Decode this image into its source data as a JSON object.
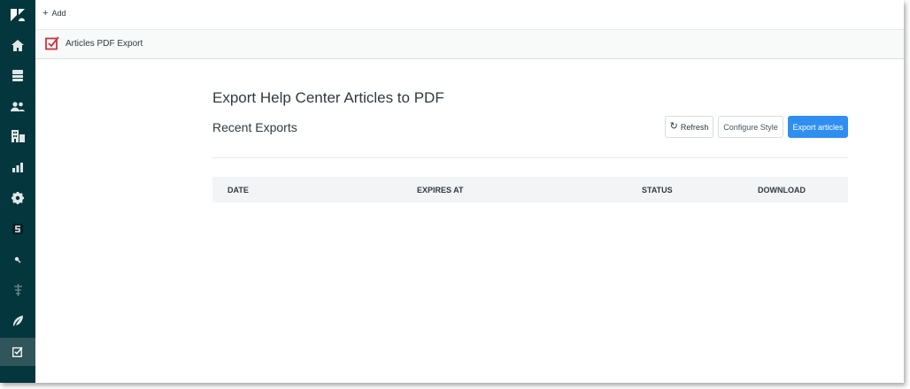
{
  "sidebar": {
    "items": [
      {
        "icon": "zendesk-logo-icon"
      },
      {
        "icon": "home-icon"
      },
      {
        "icon": "views-icon"
      },
      {
        "icon": "customers-icon"
      },
      {
        "icon": "organizations-icon"
      },
      {
        "icon": "reporting-icon"
      },
      {
        "icon": "admin-gear-icon"
      },
      {
        "icon": "app-s-icon"
      },
      {
        "icon": "search-dot-icon"
      },
      {
        "icon": "apps-tree-icon"
      },
      {
        "icon": "feather-icon"
      },
      {
        "icon": "articles-pdf-export-icon",
        "active": true
      }
    ],
    "background": "#03363d",
    "active_background": "#30555a"
  },
  "topbar": {
    "add_label": "Add"
  },
  "app_tab": {
    "label": "Articles PDF Export",
    "icon_color": "#cc3340"
  },
  "main": {
    "title": "Export Help Center Articles to PDF",
    "section_title": "Recent Exports",
    "buttons": {
      "refresh": "Refresh",
      "configure": "Configure Style",
      "export": "Export articles"
    },
    "table": {
      "columns": [
        "DATE",
        "EXPIRES AT",
        "STATUS",
        "DOWNLOAD"
      ],
      "rows": []
    }
  },
  "colors": {
    "accent": "#2f8ff0",
    "text": "#2f3941"
  }
}
